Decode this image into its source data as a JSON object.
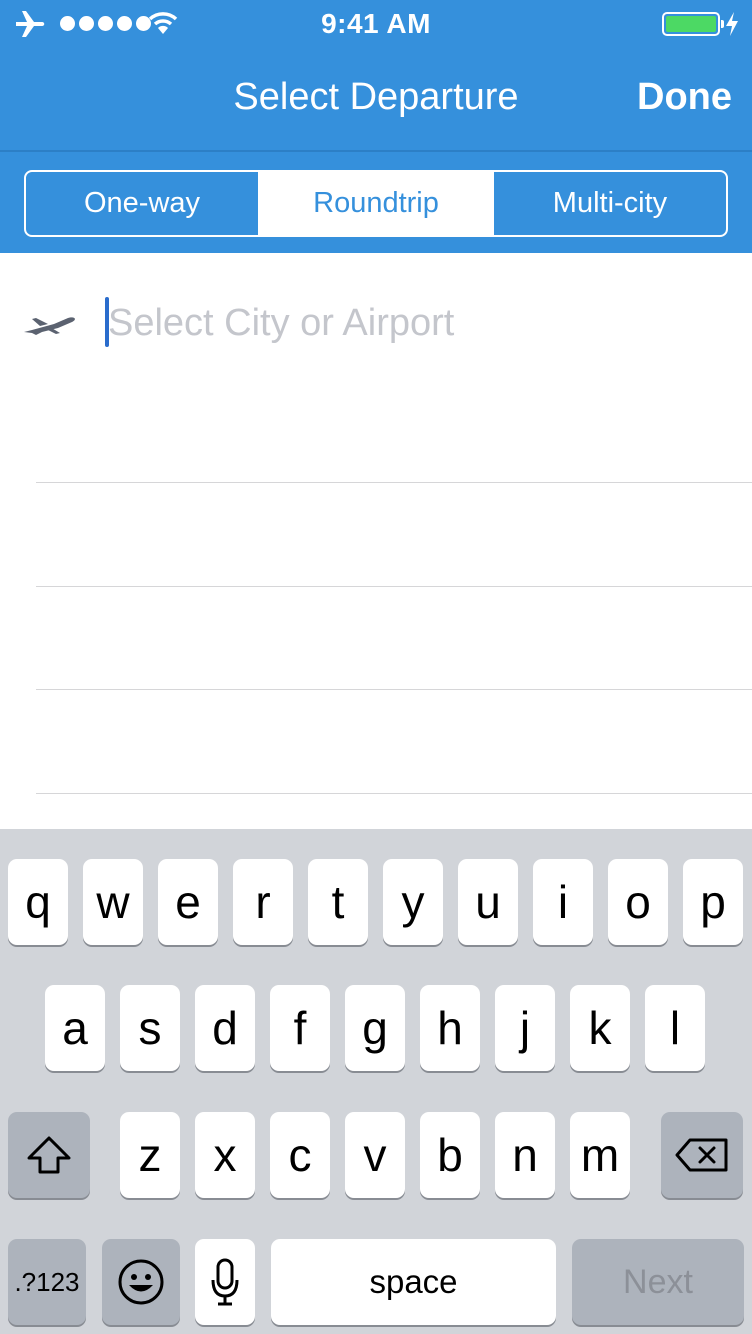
{
  "status_bar": {
    "time": "9:41 AM",
    "airplane_icon": "airplane-mode-icon",
    "signal_icon": "signal-dots-icon",
    "wifi_icon": "wifi-icon",
    "battery_icon": "battery-icon",
    "battery_level": 1.0,
    "charging_icon": "bolt-icon"
  },
  "nav": {
    "title": "Select Departure",
    "done_label": "Done"
  },
  "trip_type": {
    "options": [
      "One-way",
      "Roundtrip",
      "Multi-city"
    ],
    "selected": "Roundtrip"
  },
  "search": {
    "icon": "departing-plane-icon",
    "value": "",
    "placeholder": "Select City or Airport"
  },
  "keyboard": {
    "row1": [
      "q",
      "w",
      "e",
      "r",
      "t",
      "y",
      "u",
      "i",
      "o",
      "p"
    ],
    "row2": [
      "a",
      "s",
      "d",
      "f",
      "g",
      "h",
      "j",
      "k",
      "l"
    ],
    "row3": [
      "z",
      "x",
      "c",
      "v",
      "b",
      "n",
      "m"
    ],
    "shift_icon": "shift-icon",
    "delete_icon": "delete-icon",
    "numbers_label": ".?123",
    "emoji_icon": "emoji-icon",
    "mic_icon": "microphone-icon",
    "space_label": "space",
    "next_label": "Next"
  },
  "colors": {
    "header": "#3590dc",
    "accent_cursor": "#2a6ccc",
    "keyboard_bg": "#d1d4d9",
    "battery_fill": "#4cd964"
  }
}
